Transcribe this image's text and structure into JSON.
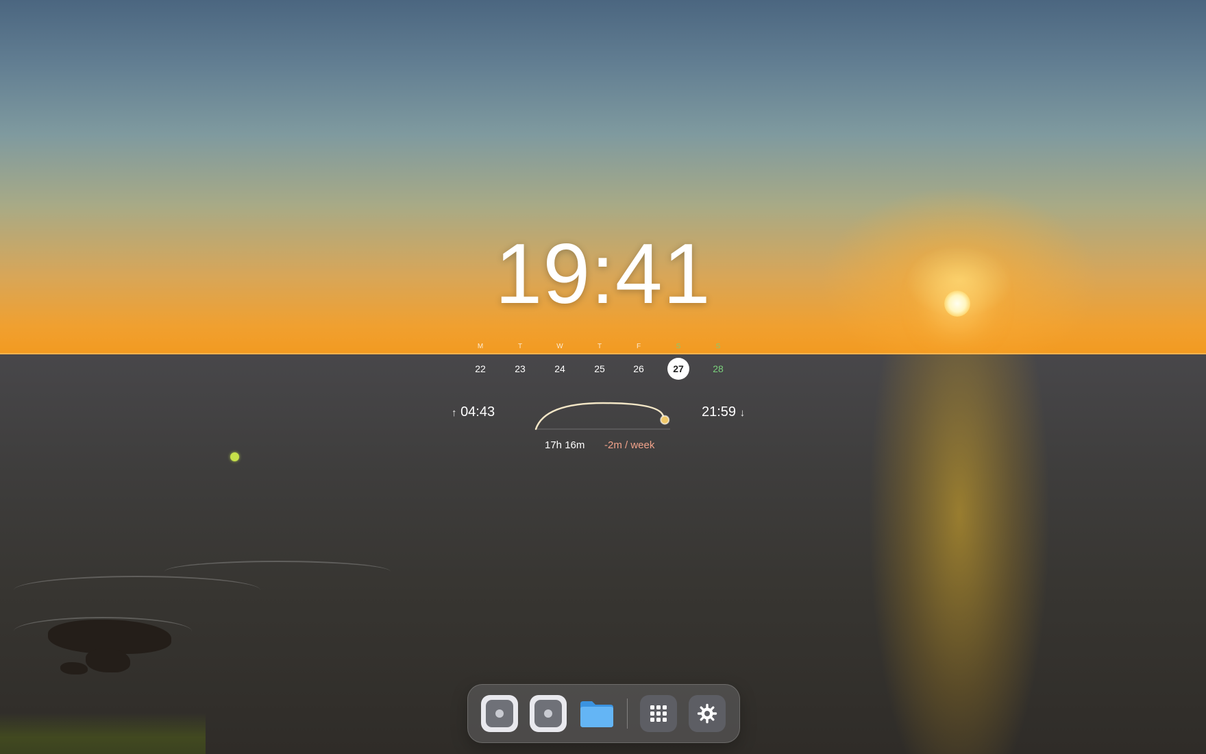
{
  "clock": {
    "time": "19:41"
  },
  "calendar": {
    "days": [
      {
        "label": "M",
        "date": "22"
      },
      {
        "label": "T",
        "date": "23"
      },
      {
        "label": "W",
        "date": "24"
      },
      {
        "label": "T",
        "date": "25"
      },
      {
        "label": "F",
        "date": "26"
      },
      {
        "label": "S",
        "date": "27"
      },
      {
        "label": "S",
        "date": "28"
      }
    ],
    "today": "27"
  },
  "sun": {
    "sunrise": "04:43",
    "sunset": "21:59",
    "day_length": "17h 16m",
    "trend": "-2m / week",
    "day_progress": 0.93
  },
  "dock": {
    "items": [
      {
        "icon": "app-icon"
      },
      {
        "icon": "app-icon"
      },
      {
        "icon": "folder-icon"
      },
      {
        "icon": "grid-icon"
      },
      {
        "icon": "gear-icon"
      }
    ]
  },
  "colors": {
    "weekend": "#7ad07c",
    "trend": "#f0a28a",
    "cursor": "#c6e04a"
  }
}
